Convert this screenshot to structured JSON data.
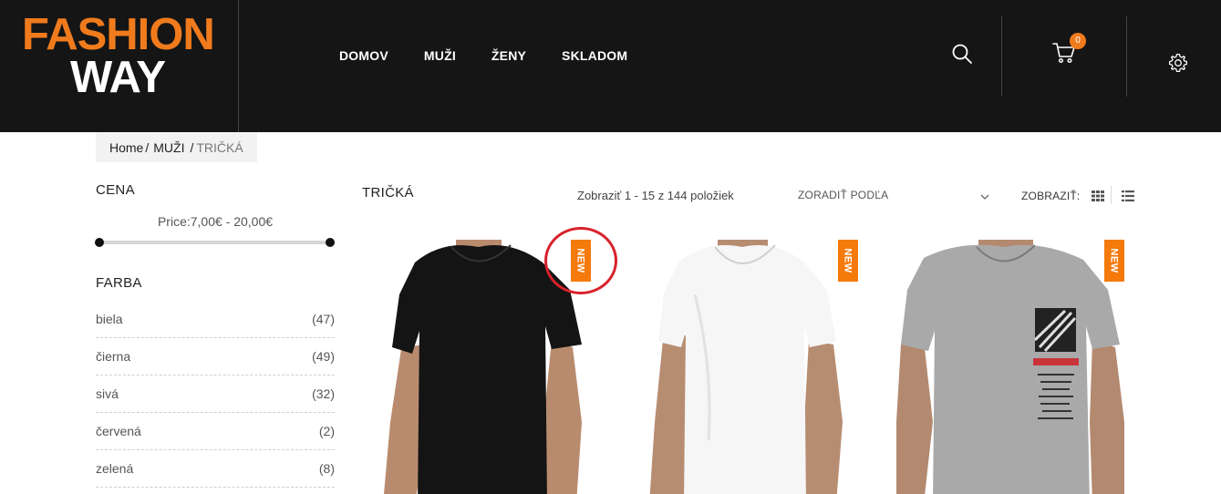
{
  "brand": {
    "line1": "FASHION",
    "line2": "WAY",
    "colors": {
      "orange": "#f07b1d",
      "header_bg": "#151515"
    }
  },
  "nav": {
    "items": [
      "DOMOV",
      "MUŽI",
      "ŽENY",
      "SKLADOM"
    ]
  },
  "header_icons": {
    "search": "search-icon",
    "cart": "cart-icon",
    "settings": "gear-icon"
  },
  "cart": {
    "count": "0"
  },
  "breadcrumb": {
    "home": "Home",
    "sep1": "/",
    "category": "MUŽI",
    "sep2": "/",
    "current": "TRIČKÁ"
  },
  "sidebar": {
    "price_title": "CENA",
    "price_range": "Price:7,00€ - 20,00€",
    "color_title": "FARBA",
    "colors": [
      {
        "name": "biela",
        "count": "(47)"
      },
      {
        "name": "čierna",
        "count": "(49)"
      },
      {
        "name": "sivá",
        "count": "(32)"
      },
      {
        "name": "červená",
        "count": "(2)"
      },
      {
        "name": "zelená",
        "count": "(8)"
      }
    ]
  },
  "main": {
    "title": "TRIČKÁ",
    "count_text": "Zobraziť 1 - 15 z 144 položiek",
    "sort_label": "ZORADIŤ PODĽA",
    "view_label": "ZOBRAZIŤ:"
  },
  "products": [
    {
      "badge": "NEW",
      "shirt_color": "#141414",
      "skin_color": "#b98b6e"
    },
    {
      "badge": "NEW",
      "shirt_color": "#f6f6f6",
      "skin_color": "#b78d72"
    },
    {
      "badge": "NEW",
      "shirt_color": "#a9a9a9",
      "skin_color": "#b38a70"
    }
  ],
  "accent": {
    "badge": "#f47a0c",
    "annotation": "#d8222c"
  }
}
